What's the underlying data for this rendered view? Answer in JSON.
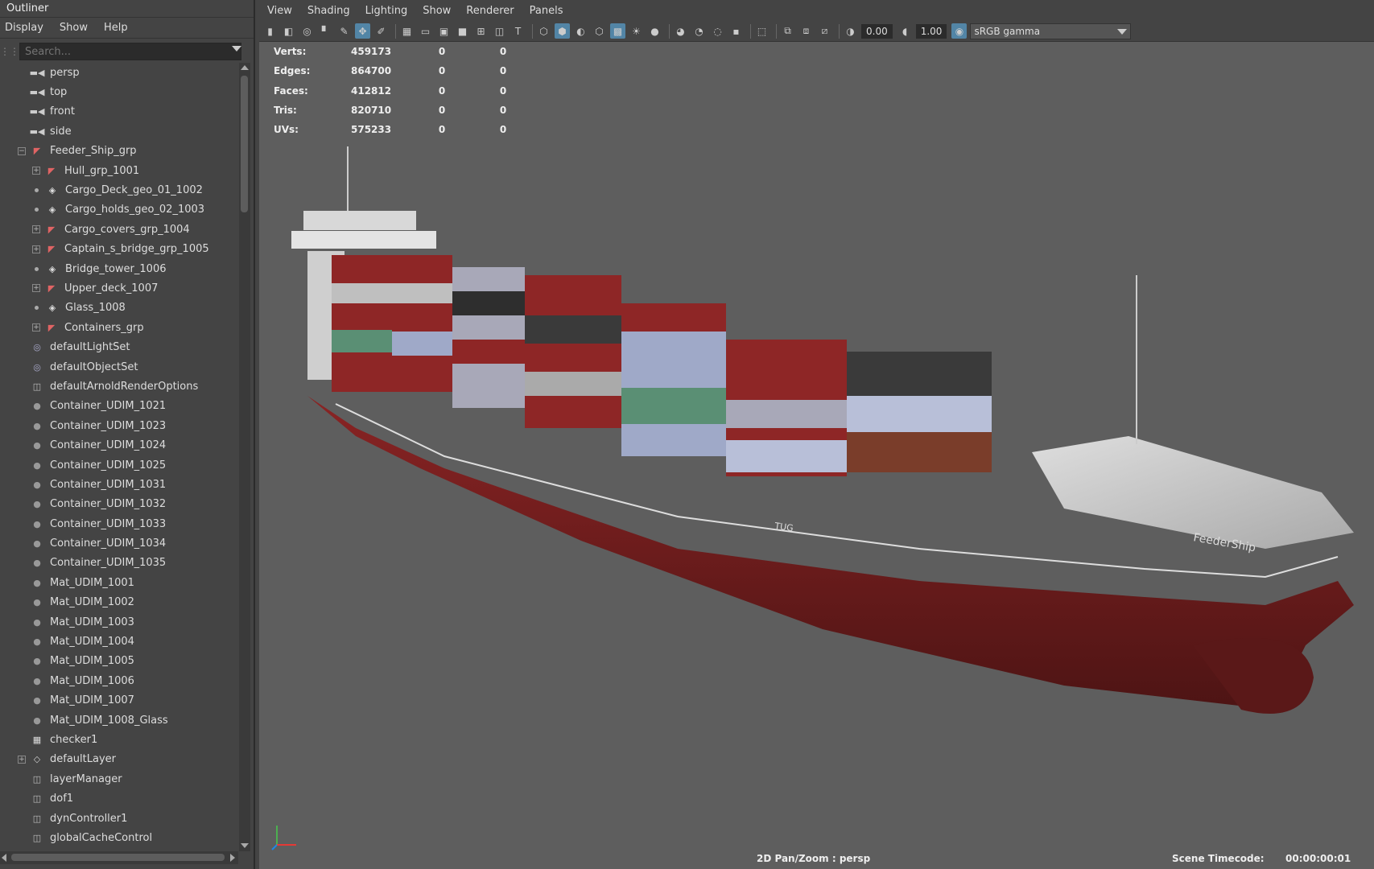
{
  "outliner": {
    "title": "Outliner",
    "menu": [
      "Display",
      "Show",
      "Help"
    ],
    "search_placeholder": "Search...",
    "items": [
      {
        "label": "persp",
        "icon": "camera-icon",
        "level": 0
      },
      {
        "label": "top",
        "icon": "camera-icon",
        "level": 0
      },
      {
        "label": "front",
        "icon": "camera-icon",
        "level": 0
      },
      {
        "label": "side",
        "icon": "camera-icon",
        "level": 0
      },
      {
        "label": "Feeder_Ship_grp",
        "icon": "group-icon",
        "level": 0,
        "expander": "collapse"
      },
      {
        "label": "Hull_grp_1001",
        "icon": "group-icon",
        "level": 1,
        "expander": "expand"
      },
      {
        "label": "Cargo_Deck_geo_01_1002",
        "icon": "mesh-icon",
        "level": 1
      },
      {
        "label": "Cargo_holds_geo_02_1003",
        "icon": "mesh-icon",
        "level": 1
      },
      {
        "label": "Cargo_covers_grp_1004",
        "icon": "group-icon",
        "level": 1,
        "expander": "expand"
      },
      {
        "label": "Captain_s_bridge_grp_1005",
        "icon": "group-icon",
        "level": 1,
        "expander": "expand"
      },
      {
        "label": "Bridge_tower_1006",
        "icon": "mesh-icon",
        "level": 1
      },
      {
        "label": "Upper_deck_1007",
        "icon": "group-icon",
        "level": 1,
        "expander": "expand"
      },
      {
        "label": "Glass_1008",
        "icon": "mesh-icon",
        "level": 1
      },
      {
        "label": "Containers_grp",
        "icon": "group-icon",
        "level": 1,
        "expander": "expand"
      },
      {
        "label": "defaultLightSet",
        "icon": "set-icon",
        "level": 0
      },
      {
        "label": "defaultObjectSet",
        "icon": "set-icon",
        "level": 0
      },
      {
        "label": "defaultArnoldRenderOptions",
        "icon": "node-icon",
        "level": 0
      },
      {
        "label": "Container_UDIM_1021",
        "icon": "material-icon",
        "level": 0
      },
      {
        "label": "Container_UDIM_1023",
        "icon": "material-icon",
        "level": 0
      },
      {
        "label": "Container_UDIM_1024",
        "icon": "material-icon",
        "level": 0
      },
      {
        "label": "Container_UDIM_1025",
        "icon": "material-icon",
        "level": 0
      },
      {
        "label": "Container_UDIM_1031",
        "icon": "material-icon",
        "level": 0
      },
      {
        "label": "Container_UDIM_1032",
        "icon": "material-icon",
        "level": 0
      },
      {
        "label": "Container_UDIM_1033",
        "icon": "material-icon",
        "level": 0
      },
      {
        "label": "Container_UDIM_1034",
        "icon": "material-icon",
        "level": 0
      },
      {
        "label": "Container_UDIM_1035",
        "icon": "material-icon",
        "level": 0
      },
      {
        "label": "Mat_UDIM_1001",
        "icon": "material-icon",
        "level": 0
      },
      {
        "label": "Mat_UDIM_1002",
        "icon": "material-icon",
        "level": 0
      },
      {
        "label": "Mat_UDIM_1003",
        "icon": "material-icon",
        "level": 0
      },
      {
        "label": "Mat_UDIM_1004",
        "icon": "material-icon",
        "level": 0
      },
      {
        "label": "Mat_UDIM_1005",
        "icon": "material-icon",
        "level": 0
      },
      {
        "label": "Mat_UDIM_1006",
        "icon": "material-icon",
        "level": 0
      },
      {
        "label": "Mat_UDIM_1007",
        "icon": "material-icon",
        "level": 0
      },
      {
        "label": "Mat_UDIM_1008_Glass",
        "icon": "material-icon",
        "level": 0
      },
      {
        "label": "checker1",
        "icon": "checker-icon",
        "level": 0
      },
      {
        "label": "defaultLayer",
        "icon": "layer-icon",
        "level": 0,
        "expander": "expand-left"
      },
      {
        "label": "layerManager",
        "icon": "node-icon",
        "level": 0
      },
      {
        "label": "dof1",
        "icon": "node-icon",
        "level": 0
      },
      {
        "label": "dynController1",
        "icon": "node-icon",
        "level": 0
      },
      {
        "label": "globalCacheControl",
        "icon": "node-icon",
        "level": 0
      }
    ]
  },
  "viewport": {
    "menu": [
      "View",
      "Shading",
      "Lighting",
      "Show",
      "Renderer",
      "Panels"
    ],
    "exposure": "0.00",
    "gamma": "1.00",
    "color_space": "sRGB gamma",
    "hud": {
      "rows": [
        {
          "label": "Verts:",
          "v1": "459173",
          "v2": "0",
          "v3": "0"
        },
        {
          "label": "Edges:",
          "v1": "864700",
          "v2": "0",
          "v3": "0"
        },
        {
          "label": "Faces:",
          "v1": "412812",
          "v2": "0",
          "v3": "0"
        },
        {
          "label": "Tris:",
          "v1": "820710",
          "v2": "0",
          "v3": "0"
        },
        {
          "label": "UVs:",
          "v1": "575233",
          "v2": "0",
          "v3": "0"
        }
      ]
    },
    "camera_label": "2D Pan/Zoom : persp",
    "timecode_label": "Scene Timecode:",
    "timecode_value": "00:00:00:01",
    "ship_text": {
      "name": "FeederShip",
      "side_mark": "TUG"
    }
  },
  "colors": {
    "panel_bg": "#444444",
    "viewport_bg": "#5e5e5e",
    "hull_red": "#7a1f1f",
    "accent_blue": "#5285a6"
  }
}
